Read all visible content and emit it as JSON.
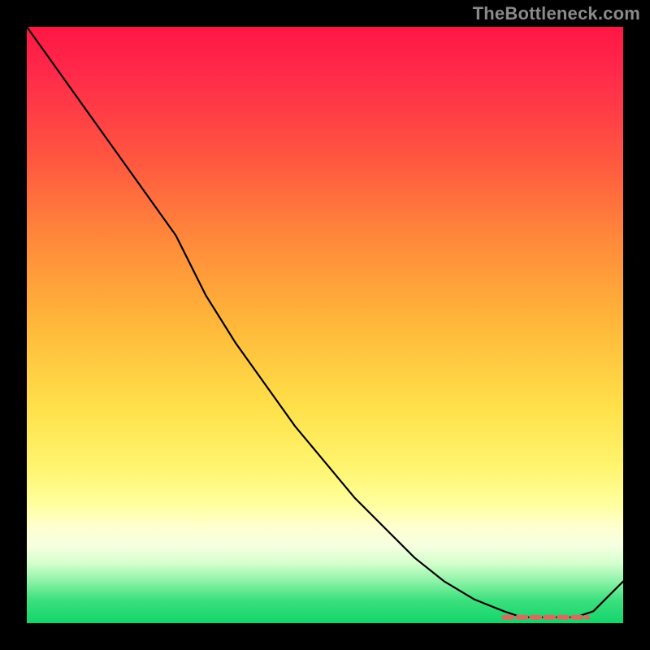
{
  "watermark": "TheBottleneck.com",
  "chart_data": {
    "type": "line",
    "title": "",
    "xlabel": "",
    "ylabel": "",
    "x": [
      0.0,
      0.05,
      0.1,
      0.15,
      0.2,
      0.25,
      0.3,
      0.35,
      0.4,
      0.45,
      0.5,
      0.55,
      0.6,
      0.65,
      0.7,
      0.75,
      0.8,
      0.83,
      0.86,
      0.89,
      0.92,
      0.95,
      1.0
    ],
    "values": [
      1.0,
      0.93,
      0.86,
      0.79,
      0.72,
      0.65,
      0.55,
      0.47,
      0.4,
      0.33,
      0.27,
      0.21,
      0.16,
      0.11,
      0.07,
      0.04,
      0.02,
      0.01,
      0.01,
      0.01,
      0.01,
      0.02,
      0.07
    ],
    "xlim": [
      0,
      1
    ],
    "ylim": [
      0,
      1
    ],
    "flat_region_x": [
      0.8,
      0.94
    ],
    "flat_region_y": 0.01,
    "gradient_stops": [
      {
        "pos": 0.0,
        "color": "#ff1744"
      },
      {
        "pos": 0.5,
        "color": "#ffe14a"
      },
      {
        "pos": 0.85,
        "color": "#ffffd0"
      },
      {
        "pos": 1.0,
        "color": "#12d46a"
      }
    ],
    "note": "Axes have no visible tick labels in the image; x and y are normalized 0–1. Curve descends near-linearly (with a slope change near x≈0.25) from top-left to a flat minimum around x≈0.80–0.94, then rises at far right."
  }
}
